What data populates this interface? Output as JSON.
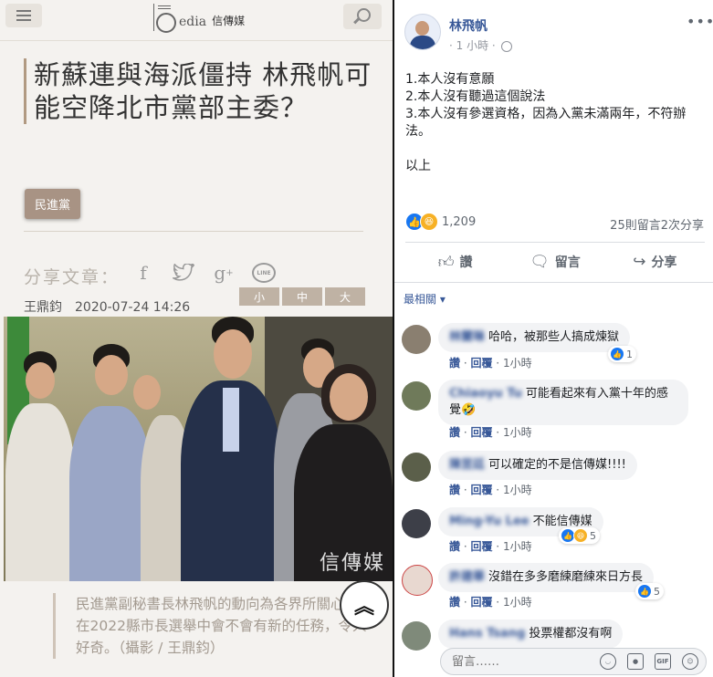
{
  "news": {
    "logo_text": "edia",
    "logo_cn": "信傳媒",
    "headline": "新蘇連與海派僵持 林飛帆可能空降北市黨部主委？",
    "tag": "民進黨",
    "share_label": "分享文章：",
    "share_icons": [
      "facebook-icon",
      "twitter-icon",
      "google-plus-icon",
      "line-icon"
    ],
    "line_label": "LINE",
    "author": "王鼎鈞　2020-07-24 14:26",
    "font_sizes": [
      "小",
      "中",
      "大"
    ],
    "watermark": "信傳媒",
    "caption": "民進黨副秘書長林飛帆的動向為各界所關心，在2022縣市長選舉中會不會有新的任務，令人好奇。（攝影 / 王鼎鈞）",
    "scroll_top_icon": "double-chevron-up-icon"
  },
  "post": {
    "author": "林飛帆",
    "time": "· 1 小時 ·",
    "more": "•••",
    "lines": [
      "1.本人沒有意願",
      "2.本人沒有聽過這個說法",
      "3.本人沒有參選資格，因為入黨未滿兩年，不符辦法。",
      "",
      "以上"
    ],
    "reaction_count": "1,209",
    "comments_shares": "25則留言2次分享",
    "actions": {
      "like": "讚",
      "comment": "留言",
      "share": "分享"
    },
    "sort": "最相關 ▾"
  },
  "comments": [
    {
      "name": "林蘭琳",
      "text": "哈哈，被那些人搞成煉獄",
      "like_label": "讚",
      "reply_label": "回覆",
      "time": "1小時",
      "reaction_count": "1"
    },
    {
      "name": "Chiaoyu Tu",
      "text": "可能看起來有入黨十年的感覺🤣",
      "like_label": "讚",
      "reply_label": "回覆",
      "time": "1小時",
      "reaction_count": ""
    },
    {
      "name": "陳昱廷",
      "text": "可以確定的不是信傳媒!!!!",
      "like_label": "讚",
      "reply_label": "回覆",
      "time": "1小時",
      "reaction_count": ""
    },
    {
      "name": "Ming-Yu Lee",
      "text": "不能信傳媒",
      "like_label": "讚",
      "reply_label": "回覆",
      "time": "1小時",
      "reaction_count": "5"
    },
    {
      "name": "許建華",
      "text": "沒錯在多多磨練磨練來日方長",
      "like_label": "讚",
      "reply_label": "回覆",
      "time": "1小時",
      "reaction_count": "5"
    },
    {
      "name": "Hans Tsang",
      "text": "投票權都沒有啊",
      "like_label": "",
      "reply_label": "",
      "time": "",
      "reaction_count": ""
    }
  ],
  "composer": {
    "placeholder": "留言……",
    "icons": [
      "emoji-icon",
      "camera-icon",
      "gif-icon",
      "sticker-icon"
    ],
    "gif_label": "GIF"
  },
  "colors": {
    "fb_blue": "#385898",
    "like_blue": "#1877f2",
    "news_accent": "#b19a82"
  }
}
